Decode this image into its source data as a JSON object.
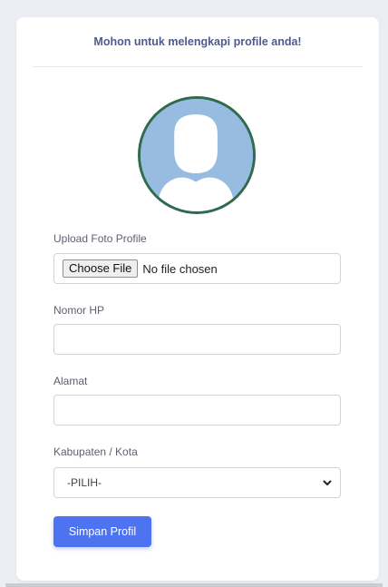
{
  "header": {
    "title": "Mohon untuk melengkapi profile anda!"
  },
  "avatar": {
    "icon": "user-silhouette-icon",
    "fill_color": "#98bbe1",
    "border_color": "#2f6b4c"
  },
  "form": {
    "photo": {
      "label": "Upload Foto Profile",
      "button_label": "Choose File",
      "status": "No file chosen"
    },
    "phone": {
      "label": "Nomor HP",
      "value": ""
    },
    "address": {
      "label": "Alamat",
      "value": ""
    },
    "city": {
      "label": "Kabupaten / Kota",
      "selected": "-PILIH-"
    },
    "submit_label": "Simpan Profil"
  },
  "colors": {
    "accent": "#4e73f0",
    "title": "#4e5a94",
    "background": "#eceef3"
  }
}
